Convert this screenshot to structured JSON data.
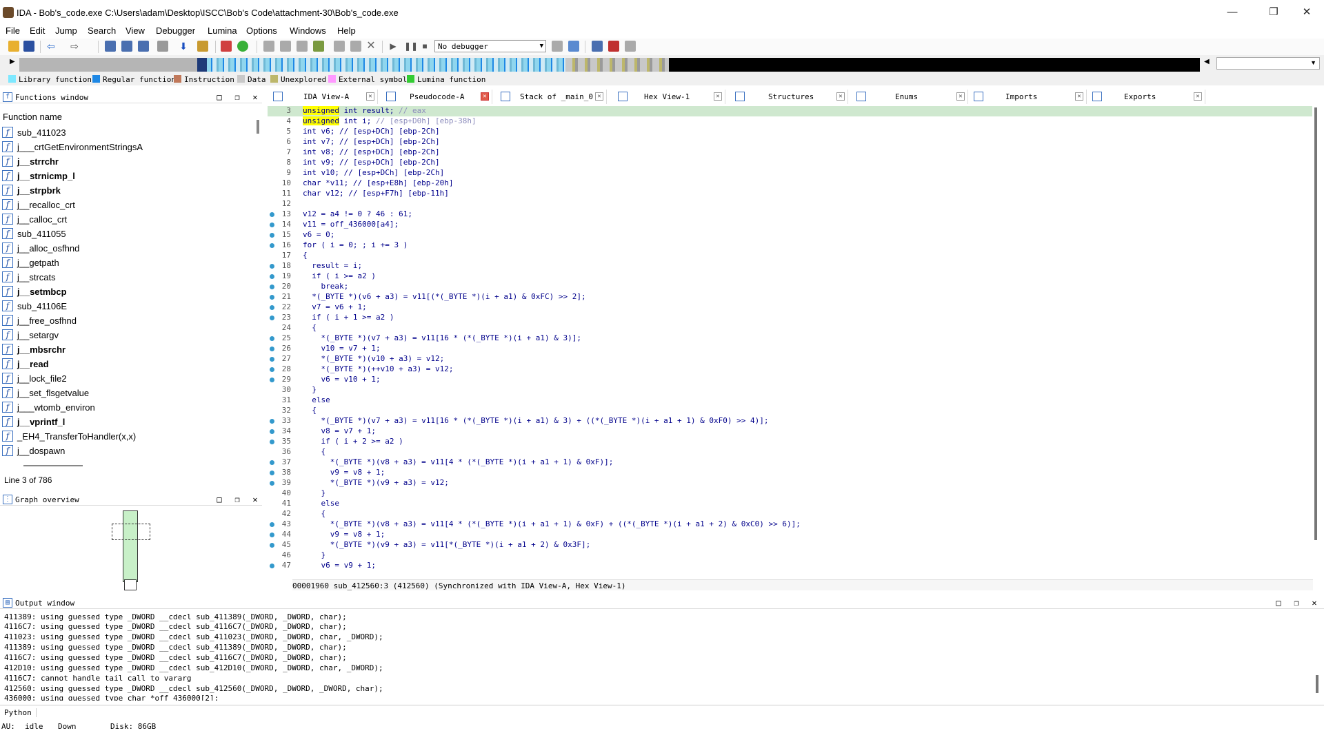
{
  "window": {
    "title": "IDA - Bob's_code.exe C:\\Users\\adam\\Desktop\\ISCC\\Bob's Code\\attachment-30\\Bob's_code.exe"
  },
  "menu": [
    "File",
    "Edit",
    "Jump",
    "Search",
    "View",
    "Debugger",
    "Lumina",
    "Options",
    "Windows",
    "Help"
  ],
  "toolbar": {
    "debugger_select": "No debugger"
  },
  "legend": [
    {
      "label": "Library function",
      "color": "#7ee8ff"
    },
    {
      "label": "Regular function",
      "color": "#1e88e5"
    },
    {
      "label": "Instruction",
      "color": "#c0785a"
    },
    {
      "label": "Data",
      "color": "#c8c8c8"
    },
    {
      "label": "Unexplored",
      "color": "#bdb76b"
    },
    {
      "label": "External symbol",
      "color": "#ff99ff"
    },
    {
      "label": "Lumina function",
      "color": "#33cc33"
    }
  ],
  "functions_window": {
    "title": "Functions window",
    "column": "Function name",
    "items": [
      {
        "name": "sub_411023",
        "bold": false
      },
      {
        "name": "j___crtGetEnvironmentStringsA",
        "bold": false
      },
      {
        "name": "j__strrchr",
        "bold": true
      },
      {
        "name": "j__strnicmp_l",
        "bold": true
      },
      {
        "name": "j__strpbrk",
        "bold": true
      },
      {
        "name": "j__recalloc_crt",
        "bold": false
      },
      {
        "name": "j__calloc_crt",
        "bold": false
      },
      {
        "name": "sub_411055",
        "bold": false
      },
      {
        "name": "j__alloc_osfhnd",
        "bold": false
      },
      {
        "name": "j__getpath",
        "bold": false
      },
      {
        "name": "j__strcats",
        "bold": false
      },
      {
        "name": "j__setmbcp",
        "bold": true
      },
      {
        "name": "sub_41106E",
        "bold": false
      },
      {
        "name": "j__free_osfhnd",
        "bold": false
      },
      {
        "name": "j__setargv",
        "bold": false
      },
      {
        "name": "j__mbsrchr",
        "bold": true
      },
      {
        "name": "j__read",
        "bold": true
      },
      {
        "name": "j__lock_file2",
        "bold": false
      },
      {
        "name": "j__set_flsgetvalue",
        "bold": false
      },
      {
        "name": "j___wtomb_environ",
        "bold": false
      },
      {
        "name": "j__vprintf_l",
        "bold": true
      },
      {
        "name": "_EH4_TransferToHandler(x,x)",
        "bold": false
      },
      {
        "name": "j__dospawn",
        "bold": false
      }
    ],
    "status": "Line 3 of 786"
  },
  "graph_overview": {
    "title": "Graph overview"
  },
  "tabs": [
    {
      "label": "IDA View-A",
      "active": false
    },
    {
      "label": "Pseudocode-A",
      "active": true
    },
    {
      "label": "Stack of _main_0",
      "active": false
    },
    {
      "label": "Hex View-1",
      "active": false
    },
    {
      "label": "Structures",
      "active": false
    },
    {
      "label": "Enums",
      "active": false
    },
    {
      "label": "Imports",
      "active": false
    },
    {
      "label": "Exports",
      "active": false
    }
  ],
  "code": {
    "lines": [
      {
        "n": "3",
        "dot": false,
        "text": "unsigned int result; // eax"
      },
      {
        "n": "4",
        "dot": false,
        "text": "unsigned int i; // [esp+D0h] [ebp-38h]"
      },
      {
        "n": "5",
        "dot": false,
        "text": "int v6; // [esp+DCh] [ebp-2Ch]"
      },
      {
        "n": "6",
        "dot": false,
        "text": "int v7; // [esp+DCh] [ebp-2Ch]"
      },
      {
        "n": "7",
        "dot": false,
        "text": "int v8; // [esp+DCh] [ebp-2Ch]"
      },
      {
        "n": "8",
        "dot": false,
        "text": "int v9; // [esp+DCh] [ebp-2Ch]"
      },
      {
        "n": "9",
        "dot": false,
        "text": "int v10; // [esp+DCh] [ebp-2Ch]"
      },
      {
        "n": "10",
        "dot": false,
        "text": "char *v11; // [esp+E8h] [ebp-20h]"
      },
      {
        "n": "11",
        "dot": false,
        "text": "char v12; // [esp+F7h] [ebp-11h]"
      },
      {
        "n": "12",
        "dot": false,
        "text": ""
      },
      {
        "n": "13",
        "dot": true,
        "text": "v12 = a4 != 0 ? 46 : 61;"
      },
      {
        "n": "14",
        "dot": true,
        "text": "v11 = off_436000[a4];"
      },
      {
        "n": "15",
        "dot": true,
        "text": "v6 = 0;"
      },
      {
        "n": "16",
        "dot": true,
        "text": "for ( i = 0; ; i += 3 )"
      },
      {
        "n": "17",
        "dot": false,
        "text": "{"
      },
      {
        "n": "18",
        "dot": true,
        "text": "  result = i;"
      },
      {
        "n": "19",
        "dot": true,
        "text": "  if ( i >= a2 )"
      },
      {
        "n": "20",
        "dot": true,
        "text": "    break;"
      },
      {
        "n": "21",
        "dot": true,
        "text": "  *(_BYTE *)(v6 + a3) = v11[(*(_BYTE *)(i + a1) & 0xFC) >> 2];"
      },
      {
        "n": "22",
        "dot": true,
        "text": "  v7 = v6 + 1;"
      },
      {
        "n": "23",
        "dot": true,
        "text": "  if ( i + 1 >= a2 )"
      },
      {
        "n": "24",
        "dot": false,
        "text": "  {"
      },
      {
        "n": "25",
        "dot": true,
        "text": "    *(_BYTE *)(v7 + a3) = v11[16 * (*(_BYTE *)(i + a1) & 3)];"
      },
      {
        "n": "26",
        "dot": true,
        "text": "    v10 = v7 + 1;"
      },
      {
        "n": "27",
        "dot": true,
        "text": "    *(_BYTE *)(v10 + a3) = v12;"
      },
      {
        "n": "28",
        "dot": true,
        "text": "    *(_BYTE *)(++v10 + a3) = v12;"
      },
      {
        "n": "29",
        "dot": true,
        "text": "    v6 = v10 + 1;"
      },
      {
        "n": "30",
        "dot": false,
        "text": "  }"
      },
      {
        "n": "31",
        "dot": false,
        "text": "  else"
      },
      {
        "n": "32",
        "dot": false,
        "text": "  {"
      },
      {
        "n": "33",
        "dot": true,
        "text": "    *(_BYTE *)(v7 + a3) = v11[16 * (*(_BYTE *)(i + a1) & 3) + ((*(_BYTE *)(i + a1 + 1) & 0xF0) >> 4)];"
      },
      {
        "n": "34",
        "dot": true,
        "text": "    v8 = v7 + 1;"
      },
      {
        "n": "35",
        "dot": true,
        "text": "    if ( i + 2 >= a2 )"
      },
      {
        "n": "36",
        "dot": false,
        "text": "    {"
      },
      {
        "n": "37",
        "dot": true,
        "text": "      *(_BYTE *)(v8 + a3) = v11[4 * (*(_BYTE *)(i + a1 + 1) & 0xF)];"
      },
      {
        "n": "38",
        "dot": true,
        "text": "      v9 = v8 + 1;"
      },
      {
        "n": "39",
        "dot": true,
        "text": "      *(_BYTE *)(v9 + a3) = v12;"
      },
      {
        "n": "40",
        "dot": false,
        "text": "    }"
      },
      {
        "n": "41",
        "dot": false,
        "text": "    else"
      },
      {
        "n": "42",
        "dot": false,
        "text": "    {"
      },
      {
        "n": "43",
        "dot": true,
        "text": "      *(_BYTE *)(v8 + a3) = v11[4 * (*(_BYTE *)(i + a1 + 1) & 0xF) + ((*(_BYTE *)(i + a1 + 2) & 0xC0) >> 6)];"
      },
      {
        "n": "44",
        "dot": true,
        "text": "      v9 = v8 + 1;"
      },
      {
        "n": "45",
        "dot": true,
        "text": "      *(_BYTE *)(v9 + a3) = v11[*(_BYTE *)(i + a1 + 2) & 0x3F];"
      },
      {
        "n": "46",
        "dot": false,
        "text": "    }"
      },
      {
        "n": "47",
        "dot": true,
        "text": "    v6 = v9 + 1;"
      }
    ],
    "status": "00001960 sub_412560:3 (412560) (Synchronized with IDA View-A, Hex View-1)"
  },
  "output_window": {
    "title": "Output window",
    "lines": [
      "411389: using guessed type _DWORD __cdecl sub_411389(_DWORD, _DWORD, char);",
      "4116C7: using guessed type _DWORD __cdecl sub_4116C7(_DWORD, _DWORD, char);",
      "411023: using guessed type _DWORD __cdecl sub_411023(_DWORD, _DWORD, char, _DWORD);",
      "411389: using guessed type _DWORD __cdecl sub_411389(_DWORD, _DWORD, char);",
      "4116C7: using guessed type _DWORD __cdecl sub_4116C7(_DWORD, _DWORD, char);",
      "412D10: using guessed type _DWORD __cdecl sub_412D10(_DWORD, _DWORD, char, _DWORD);",
      "4116C7: cannot handle tail call to vararg",
      "412560: using guessed type _DWORD __cdecl sub_412560(_DWORD, _DWORD, _DWORD, char);",
      "436000: using guessed type char *off_436000[2];"
    ]
  },
  "python_label": "Python",
  "statusbar": {
    "au": "AU:",
    "state": "idle",
    "dir": "Down",
    "disk": "Disk: 86GB"
  }
}
